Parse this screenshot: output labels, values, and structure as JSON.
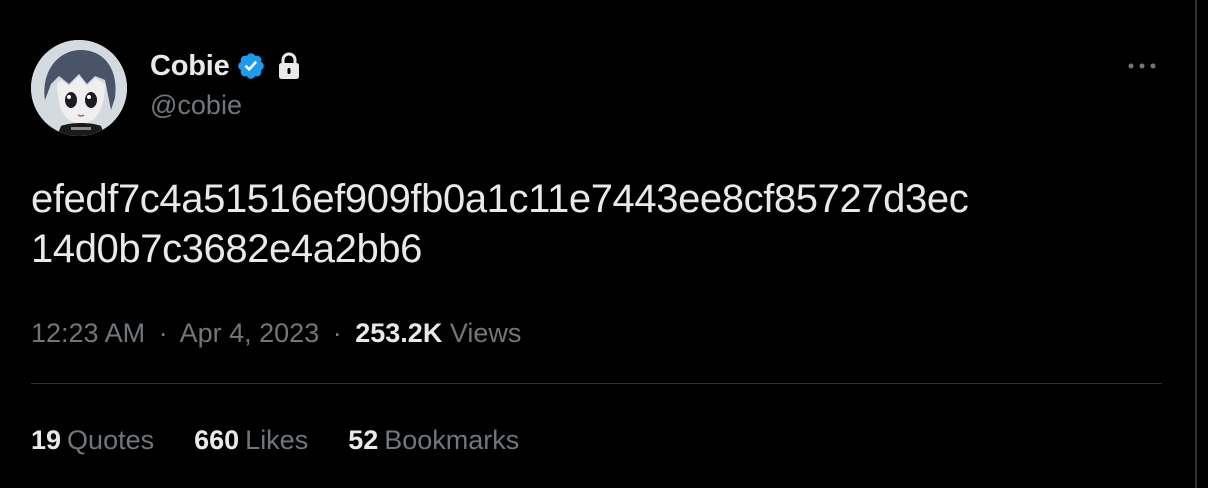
{
  "author": {
    "name": "Cobie",
    "handle": "@cobie",
    "verified_icon": "verified-badge-icon",
    "lock_icon": "lock-icon",
    "avatar": "anime-avatar-image"
  },
  "more_menu": {
    "icon": "more-horizontal-icon"
  },
  "tweet": {
    "text_line_1": "efedf7c4a51516ef909fb0a1c11e7443ee8cf85727d3ec",
    "text_line_2": "14d0b7c3682e4a2bb6"
  },
  "meta": {
    "time": "12:23 AM",
    "separator": "·",
    "date": "Apr 4, 2023",
    "views_count": "253.2K",
    "views_label": "Views"
  },
  "stats": [
    {
      "count": "19",
      "label": "Quotes"
    },
    {
      "count": "660",
      "label": "Likes"
    },
    {
      "count": "52",
      "label": "Bookmarks"
    }
  ],
  "colors": {
    "background": "#000000",
    "primary_text": "#e7e9ea",
    "secondary_text": "#71767b",
    "verified_blue": "#1d9bf0",
    "divider": "#2f3336"
  }
}
